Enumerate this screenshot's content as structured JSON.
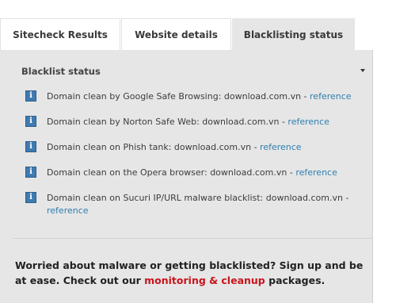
{
  "tabs": [
    {
      "label": "Sitecheck Results"
    },
    {
      "label": "Website details"
    },
    {
      "label": "Blacklisting status",
      "active": true
    }
  ],
  "section": {
    "title": "Blacklist status",
    "toggle_icon": "caret-down-icon"
  },
  "rows": [
    {
      "text": "Domain clean by Google Safe Browsing: download.com.vn",
      "sep": " - ",
      "link": "reference",
      "icon": "info-icon"
    },
    {
      "text": "Domain clean by Norton Safe Web: download.com.vn",
      "sep": " - ",
      "link": "reference",
      "icon": "info-icon"
    },
    {
      "text": "Domain clean on Phish tank: download.com.vn",
      "sep": " - ",
      "link": "reference",
      "icon": "info-icon"
    },
    {
      "text": "Domain clean on the Opera browser: download.com.vn",
      "sep": " - ",
      "link": "reference",
      "icon": "info-icon"
    },
    {
      "text": "Domain clean on Sucuri IP/URL malware blacklist: download.com.vn",
      "sep": " - ",
      "link": "reference",
      "icon": "info-icon"
    }
  ],
  "cta": {
    "text_before": "Worried about malware or getting blacklisted? Sign up and be at ease. Check out our ",
    "link": "monitoring & cleanup",
    "text_after": " packages."
  },
  "colors": {
    "panel_bg": "#e6e6e6",
    "link_blue": "#2f7fb0",
    "link_red": "#c8141c",
    "icon_blue": "#3f7ab0"
  }
}
